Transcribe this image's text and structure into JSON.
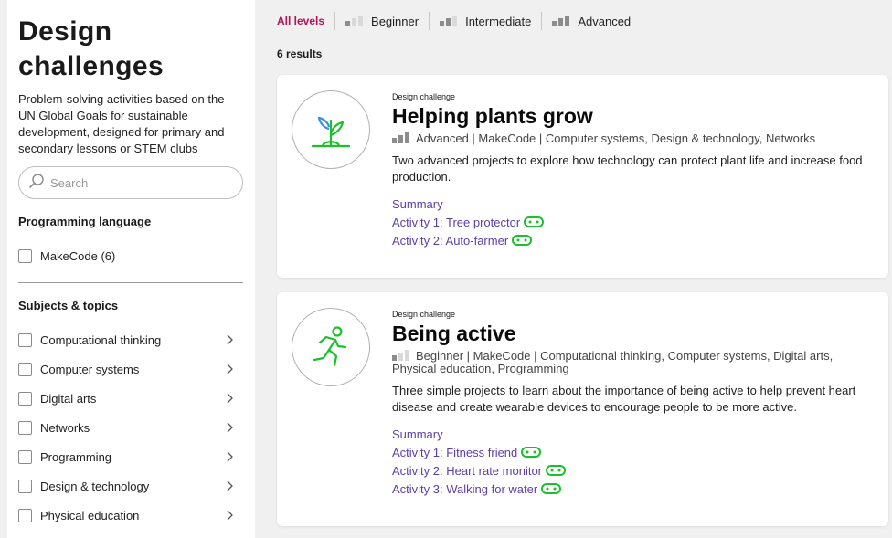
{
  "sidebar": {
    "title": "Design challenges",
    "description": "Problem-solving activities based on the UN Global Goals for sustainable development, designed for primary and secondary lessons or STEM clubs",
    "search_placeholder": "Search",
    "programming_heading": "Programming language",
    "programming_items": [
      {
        "label": "MakeCode (6)"
      }
    ],
    "subjects_heading": "Subjects & topics",
    "subject_items": [
      {
        "label": "Computational thinking"
      },
      {
        "label": "Computer systems"
      },
      {
        "label": "Digital arts"
      },
      {
        "label": "Networks"
      },
      {
        "label": "Programming"
      },
      {
        "label": "Design & technology"
      },
      {
        "label": "Physical education"
      }
    ]
  },
  "levels": {
    "items": [
      {
        "label": "All levels",
        "active": true,
        "bars": 0
      },
      {
        "label": "Beginner",
        "active": false,
        "bars": 1
      },
      {
        "label": "Intermediate",
        "active": false,
        "bars": 2
      },
      {
        "label": "Advanced",
        "active": false,
        "bars": 3
      }
    ]
  },
  "results_count": "6 results",
  "cards": [
    {
      "kicker": "Design challenge",
      "title": "Helping plants grow",
      "meta": "Advanced | MakeCode | Computer systems, Design & technology, Networks",
      "level_bars": 3,
      "description": "Two advanced projects to explore how technology can protect plant life and increase food production.",
      "icon": "plant-icon",
      "links": [
        "Summary",
        "Activity 1: Tree protector",
        "Activity 2: Auto-farmer"
      ]
    },
    {
      "kicker": "Design challenge",
      "title": "Being active",
      "meta": "Beginner | MakeCode | Computational thinking, Computer systems, Digital arts, Physical education, Programming",
      "level_bars": 1,
      "description": "Three simple projects to learn about the importance of being active to help prevent heart disease and create wearable devices to encourage people to be more active.",
      "icon": "runner-icon",
      "links": [
        "Summary",
        "Activity 1: Fitness friend",
        "Activity 2: Heart rate monitor",
        "Activity 3: Walking for water"
      ]
    }
  ],
  "colors": {
    "accent": "#b0165a",
    "link": "#5c3fa8",
    "icon_green": "#19c12a",
    "icon_blue": "#3a8fe0",
    "background": "#f0f0f0"
  }
}
